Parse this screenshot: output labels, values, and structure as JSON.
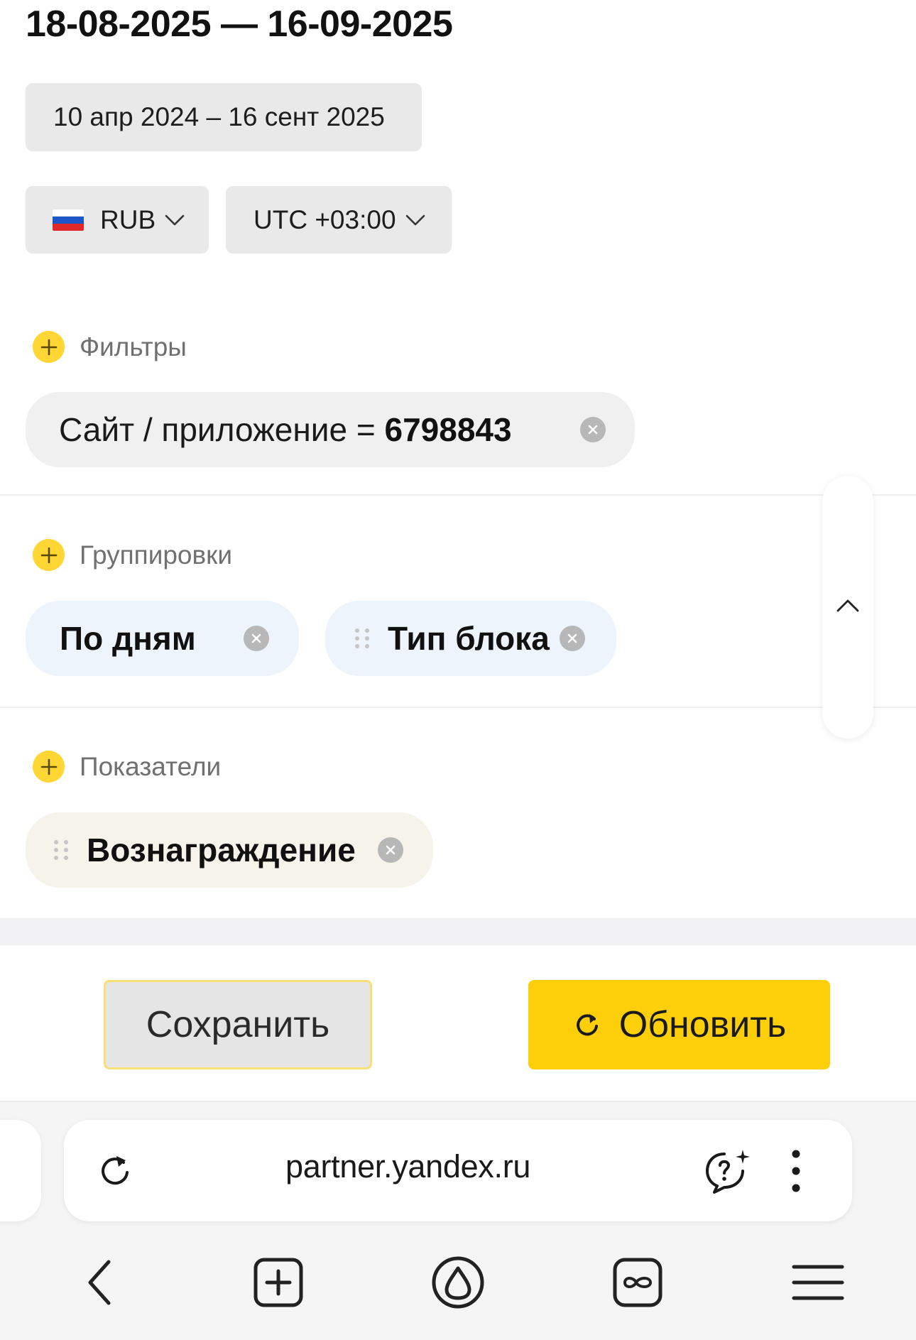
{
  "header": {
    "range_title": "18-08-2025 — 16-09-2025",
    "date_range": "10 апр 2024 – 16 сент 2025",
    "currency": "RUB",
    "timezone": "UTC +03:00"
  },
  "filters": {
    "title": "Фильтры",
    "chip": {
      "label": "Сайт / приложение = ",
      "value": "6798843"
    }
  },
  "groupings": {
    "title": "Группировки",
    "chips": [
      "По дням",
      "Тип блока"
    ]
  },
  "metrics": {
    "title": "Показатели",
    "chips": [
      "Вознаграждение"
    ]
  },
  "actions": {
    "save_label": "Сохранить",
    "refresh_label": "Обновить"
  },
  "browser": {
    "url": "partner.yandex.ru"
  },
  "colors": {
    "accent_yellow": "#fccf0a",
    "plus_yellow": "#ffd633",
    "grouping_chip_bg": "#edf4fc",
    "metric_chip_bg": "#f6f3ea",
    "pill_bg": "#e9e9e9"
  },
  "icons": {
    "flag": "russia-flag-icon",
    "dropdown": "chevron-down-icon",
    "add": "plus-icon",
    "remove": "clear-icon",
    "drag": "drag-handle-icon",
    "collapse": "chevron-up-icon",
    "refresh": "refresh-icon",
    "reload": "reload-icon",
    "assistant": "ai-help-icon",
    "menu": "more-vertical-icon",
    "back": "back-icon",
    "new_tab": "new-tab-icon",
    "alice": "alice-icon",
    "tabs": "tabs-icon",
    "hamburger": "hamburger-menu-icon"
  }
}
